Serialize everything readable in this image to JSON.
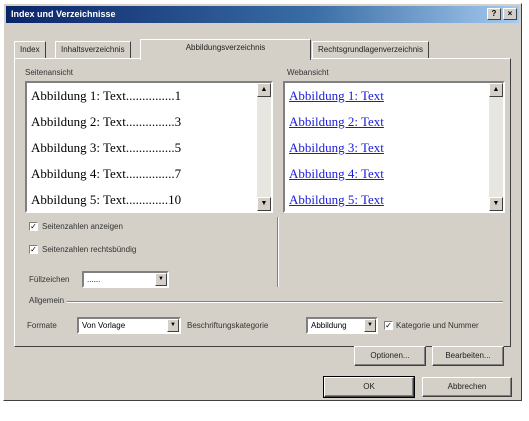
{
  "window": {
    "title": "Index und Verzeichnisse"
  },
  "tabs": [
    {
      "label": "Index"
    },
    {
      "label": "Inhaltsverzeichnis"
    },
    {
      "label": "Abbildungsverzeichnis"
    },
    {
      "label": "Rechtsgrundlagenverzeichnis"
    }
  ],
  "print_preview": {
    "label": "Seitenansicht",
    "lines": [
      {
        "text": "Abbildung 1: Text...............1"
      },
      {
        "text": "Abbildung 2: Text...............3"
      },
      {
        "text": "Abbildung 3: Text...............5"
      },
      {
        "text": "Abbildung 4: Text...............7"
      },
      {
        "text": "Abbildung 5: Text.............10"
      }
    ]
  },
  "web_preview": {
    "label": "Webansicht",
    "lines": [
      {
        "text": "Abbildung 1: Text"
      },
      {
        "text": "Abbildung 2: Text"
      },
      {
        "text": "Abbildung 3: Text"
      },
      {
        "text": "Abbildung 4: Text"
      },
      {
        "text": "Abbildung 5: Text"
      }
    ]
  },
  "options": {
    "show_page_numbers": {
      "label": "Seitenzahlen anzeigen",
      "checked": true
    },
    "right_align": {
      "label": "Seitenzahlen rechtsbündig",
      "checked": true
    },
    "tab_leader": {
      "label": "Füllzeichen",
      "value": "......"
    }
  },
  "general": {
    "label": "Allgemein",
    "formats": {
      "label": "Formate",
      "value": "Von Vorlage"
    },
    "caption_label": {
      "label": "Beschriftungskategorie",
      "value": "Abbildung"
    },
    "include_label": {
      "label": "Kategorie und Nummer",
      "checked": true
    }
  },
  "buttons": {
    "options": "Optionen...",
    "modify": "Bearbeiten...",
    "ok": "OK",
    "cancel": "Abbrechen"
  },
  "icons": {
    "help": "help-icon",
    "close": "close-icon",
    "check": "checkmark-icon",
    "arrow_down": "arrow-down-icon",
    "arrow_up": "arrow-up-icon"
  },
  "colors": {
    "title_start": "#0a246a",
    "title_end": "#a6caf0",
    "link": "#1a1adc",
    "face": "#d4d0c8"
  }
}
